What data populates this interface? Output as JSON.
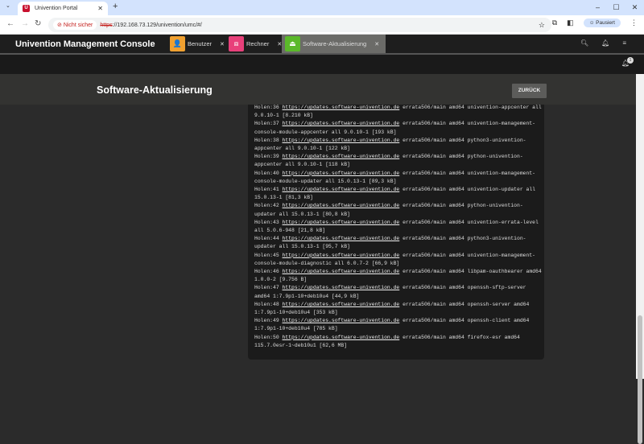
{
  "browser": {
    "tab_title": "Univention Portal",
    "url_scheme": "https",
    "url_rest": "://192.168.73.129/univention/umc/#/",
    "security": "Nicht sicher",
    "profile": "Pausiert"
  },
  "umc": {
    "title": "Univention Management Console",
    "tabs": [
      {
        "label": "Benutzer",
        "color": "#f0a030"
      },
      {
        "label": "Rechner",
        "color": "#e8407a"
      },
      {
        "label": "Software-Aktualisierung",
        "color": "#5bb92a"
      }
    ],
    "notification_count": "1"
  },
  "page": {
    "title": "Software-Aktualisierung",
    "back_label": "ZURÜCK"
  },
  "log": [
    {
      "id": "Holen:36",
      "url": "https://updates.software-univention.de",
      "l1": " errata506/main amd64 univention-appcenter all",
      "l2": "9.0.10-1 [8.210 kB]"
    },
    {
      "id": "Holen:37",
      "url": "https://updates.software-univention.de",
      "l1": " errata506/main amd64 univention-management-",
      "l2": "console-module-appcenter all 9.0.10-1 [193 kB]"
    },
    {
      "id": "Holen:38",
      "url": "https://updates.software-univention.de",
      "l1": " errata506/main amd64 python3-univention-",
      "l2": "appcenter all 9.0.10-1 [122 kB]"
    },
    {
      "id": "Holen:39",
      "url": "https://updates.software-univention.de",
      "l1": " errata506/main amd64 python-univention-",
      "l2": "appcenter all 9.0.10-1 [118 kB]"
    },
    {
      "id": "Holen:40",
      "url": "https://updates.software-univention.de",
      "l1": " errata506/main amd64 univention-management-",
      "l2": "console-module-updater all 15.0.13-1 [89,3 kB]"
    },
    {
      "id": "Holen:41",
      "url": "https://updates.software-univention.de",
      "l1": " errata506/main amd64 univention-updater all",
      "l2": "15.0.13-1 [81,3 kB]"
    },
    {
      "id": "Holen:42",
      "url": "https://updates.software-univention.de",
      "l1": " errata506/main amd64 python-univention-",
      "l2": "updater all 15.0.13-1 [80,8 kB]"
    },
    {
      "id": "Holen:43",
      "url": "https://updates.software-univention.de",
      "l1": " errata506/main amd64 univention-errata-level",
      "l2": "all 5.0.6-948 [21,8 kB]"
    },
    {
      "id": "Holen:44",
      "url": "https://updates.software-univention.de",
      "l1": " errata506/main amd64 python3-univention-",
      "l2": "updater all 15.0.13-1 [95,7 kB]"
    },
    {
      "id": "Holen:45",
      "url": "https://updates.software-univention.de",
      "l1": " errata506/main amd64 univention-management-",
      "l2": "console-module-diagnostic all 6.0.7-2 [66,9 kB]"
    },
    {
      "id": "Holen:46",
      "url": "https://updates.software-univention.de",
      "l1": " errata506/main amd64 libpam-oauthbearer amd64",
      "l2": "1.0.0-2 [9.756 B]"
    },
    {
      "id": "Holen:47",
      "url": "https://updates.software-univention.de",
      "l1": " errata506/main amd64 openssh-sftp-server",
      "l2": "amd64 1:7.9p1-10+deb10u4 [44,9 kB]"
    },
    {
      "id": "Holen:48",
      "url": "https://updates.software-univention.de",
      "l1": " errata506/main amd64 openssh-server amd64",
      "l2": "1:7.9p1-10+deb10u4 [353 kB]"
    },
    {
      "id": "Holen:49",
      "url": "https://updates.software-univention.de",
      "l1": " errata506/main amd64 openssh-client amd64",
      "l2": "1:7.9p1-10+deb10u4 [785 kB]"
    },
    {
      "id": "Holen:50",
      "url": "https://updates.software-univention.de",
      "l1": " errata506/main amd64 firefox-esr amd64",
      "l2": "115.7.0esr-1~deb10u1 [62,6 MB]"
    }
  ]
}
